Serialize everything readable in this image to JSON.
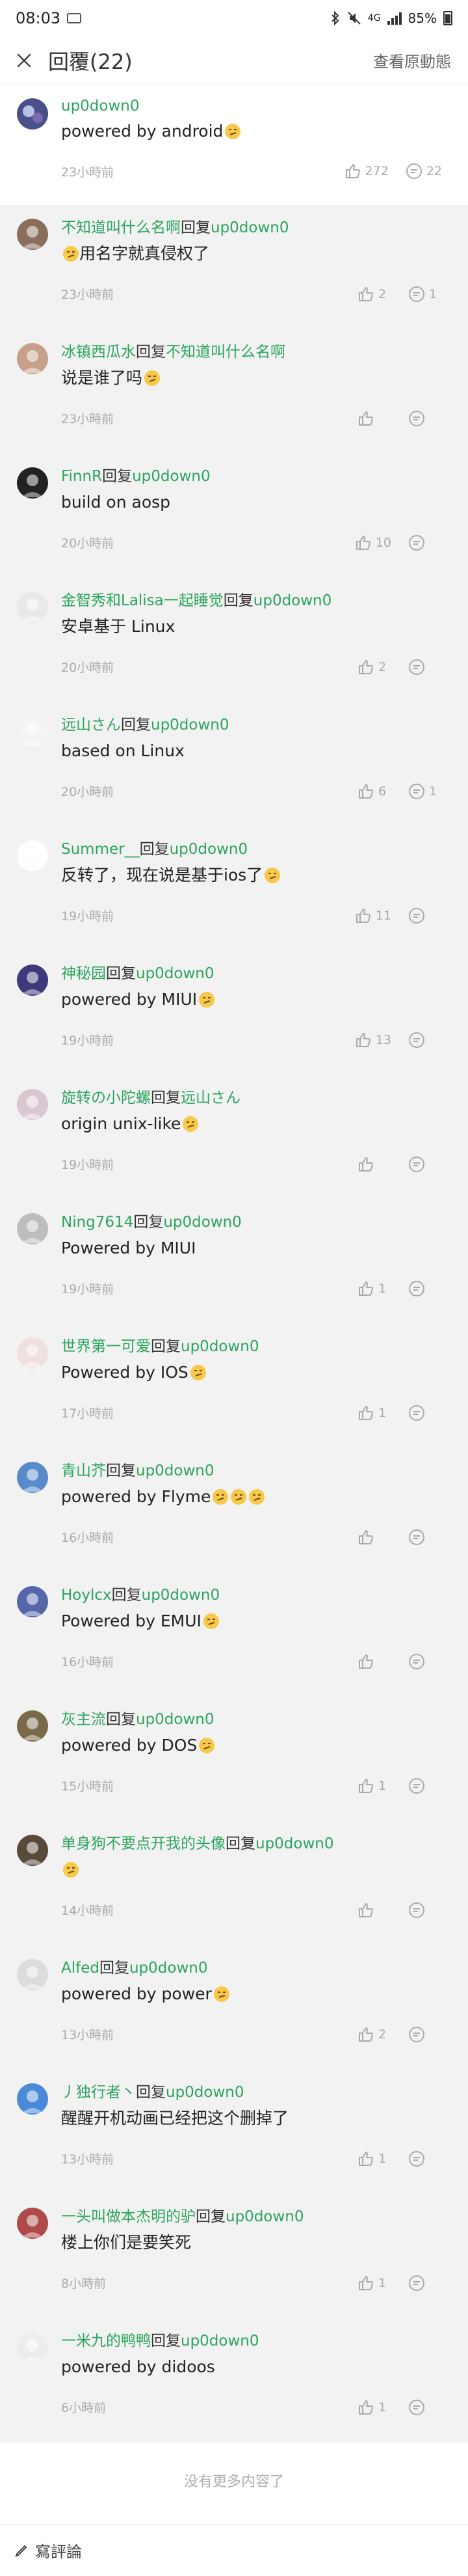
{
  "status_bar": {
    "time": "08:03",
    "network": "4G",
    "battery": "85%"
  },
  "header": {
    "title": "回覆(22)",
    "original_link": "查看原動態"
  },
  "main_post": {
    "user": "up0down0",
    "text": "powered by android",
    "time": "23小時前",
    "likes": "272",
    "replies": "22"
  },
  "comments": [
    {
      "user": "不知道叫什么名啊",
      "reply_label": "回复",
      "reply_to": "up0down0",
      "text": "用名字就真侵权了",
      "time": "23小時前",
      "likes": "2",
      "replies": "1"
    },
    {
      "user": "冰镇西瓜水",
      "reply_label": "回复",
      "reply_to": "不知道叫什么名啊",
      "text": "说是谁了吗",
      "time": "23小時前",
      "likes": "",
      "replies": ""
    },
    {
      "user": "FinnR",
      "reply_label": "回复",
      "reply_to": "up0down0",
      "text": "build on aosp",
      "time": "20小時前",
      "likes": "10",
      "replies": ""
    },
    {
      "user": "金智秀和Lalisa一起睡觉",
      "reply_label": "回复",
      "reply_to": "up0down0",
      "text": "安卓基于 Linux",
      "time": "20小時前",
      "likes": "2",
      "replies": ""
    },
    {
      "user": "远山さん",
      "reply_label": "回复",
      "reply_to": "up0down0",
      "text": "based on Linux",
      "time": "20小時前",
      "likes": "6",
      "replies": "1"
    },
    {
      "user": "Summer__",
      "reply_label": "回复",
      "reply_to": "up0down0",
      "text": "反转了，现在说是基于ios了",
      "time": "19小時前",
      "likes": "11",
      "replies": ""
    },
    {
      "user": "神秘园",
      "reply_label": "回复",
      "reply_to": "up0down0",
      "text": "powered by MIUI",
      "time": "19小時前",
      "likes": "13",
      "replies": ""
    },
    {
      "user": "旋转の小陀螺",
      "reply_label": "回复",
      "reply_to": "远山さん",
      "text": "origin unix-like",
      "time": "19小時前",
      "likes": "",
      "replies": ""
    },
    {
      "user": "Ning7614",
      "reply_label": "回复",
      "reply_to": "up0down0",
      "text": "Powered by MIUI",
      "time": "19小時前",
      "likes": "1",
      "replies": ""
    },
    {
      "user": "世界第一可爱",
      "reply_label": "回复",
      "reply_to": "up0down0",
      "text": "Powered by IOS",
      "time": "17小時前",
      "likes": "1",
      "replies": ""
    },
    {
      "user": "青山芥",
      "reply_label": "回复",
      "reply_to": "up0down0",
      "text": "powered by Flyme",
      "time": "16小時前",
      "likes": "",
      "replies": ""
    },
    {
      "user": "Hoylcx",
      "reply_label": "回复",
      "reply_to": "up0down0",
      "text": "Powered by EMUI",
      "time": "16小時前",
      "likes": "",
      "replies": ""
    },
    {
      "user": "灰主流",
      "reply_label": "回复",
      "reply_to": "up0down0",
      "text": "powered by DOS",
      "time": "15小時前",
      "likes": "1",
      "replies": ""
    },
    {
      "user": "单身狗不要点开我的头像",
      "reply_label": "回复",
      "reply_to": "up0down0",
      "text": "",
      "time": "14小時前",
      "likes": "",
      "replies": ""
    },
    {
      "user": "Alfed",
      "reply_label": "回复",
      "reply_to": "up0down0",
      "text": "powered by power",
      "time": "13小時前",
      "likes": "2",
      "replies": ""
    },
    {
      "user": "丿独行者丶",
      "reply_label": "回复",
      "reply_to": "up0down0",
      "text": "醒醒开机动画已经把这个删掉了",
      "time": "13小時前",
      "likes": "1",
      "replies": ""
    },
    {
      "user": "一头叫做本杰明的驴",
      "reply_label": "回复",
      "reply_to": "up0down0",
      "text": "楼上你们是要笑死",
      "time": "8小時前",
      "likes": "1",
      "replies": ""
    },
    {
      "user": "一米九的鸭鸭",
      "reply_label": "回复",
      "reply_to": "up0down0",
      "text": "powered by didoos",
      "time": "6小時前",
      "likes": "1",
      "replies": ""
    }
  ],
  "no_more": "没有更多内容了",
  "footer": {
    "write_label": "寫評論"
  },
  "colors": {
    "accent_green": "#2aa55c",
    "list_background": "#f2f2f2",
    "meta_gray": "#aaaaaa"
  }
}
